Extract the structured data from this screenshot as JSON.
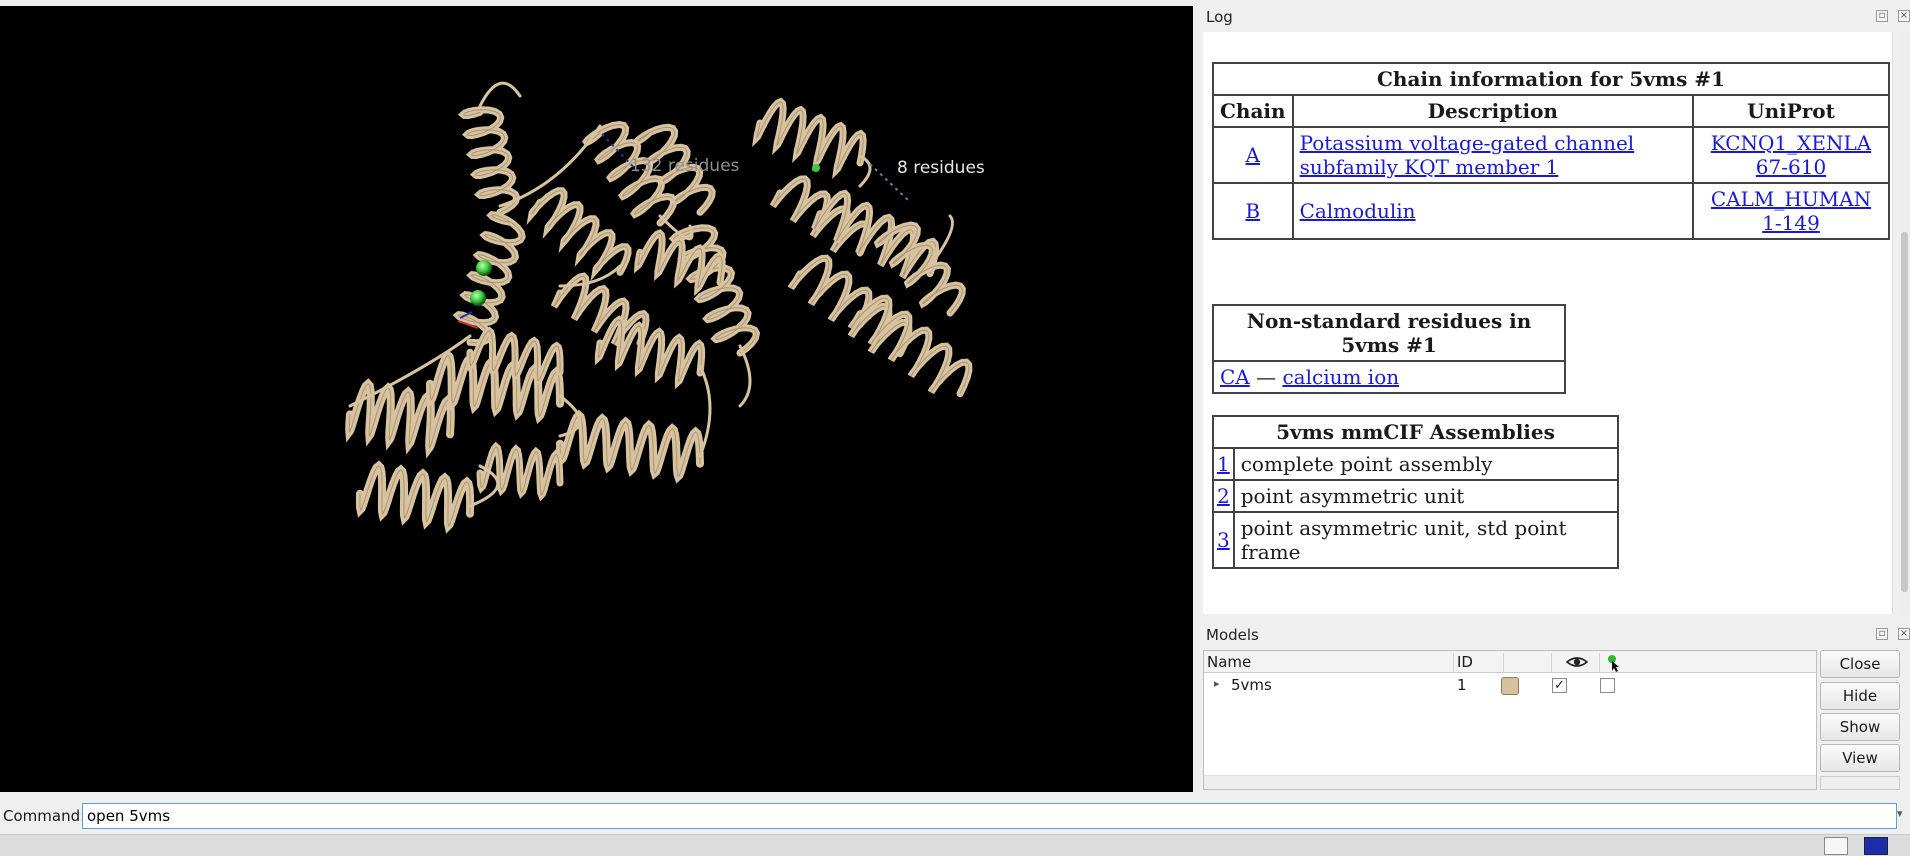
{
  "viewer": {
    "labels": {
      "residues_132": "132 residues",
      "residues_8": "8 residues"
    }
  },
  "log": {
    "title": "Log",
    "chain_table": {
      "caption": "Chain information for 5vms #1",
      "headers": [
        "Chain",
        "Description",
        "UniProt"
      ],
      "rows": [
        {
          "chain": "A",
          "description": "Potassium voltage-gated channel subfamily KQT member 1",
          "uniprot_id": "KCNQ1_XENLA",
          "uniprot_range": "67-610"
        },
        {
          "chain": "B",
          "description": "Calmodulin",
          "uniprot_id": "CALM_HUMAN",
          "uniprot_range": "1-149"
        }
      ]
    },
    "nonstd_table": {
      "caption": "Non-standard residues in 5vms #1",
      "row": {
        "code": "CA",
        "dash": "—",
        "name": "calcium ion"
      }
    },
    "assemblies_table": {
      "caption": "5vms mmCIF Assemblies",
      "rows": [
        {
          "id": "1",
          "name": "complete point assembly"
        },
        {
          "id": "2",
          "name": "point asymmetric unit"
        },
        {
          "id": "3",
          "name": "point asymmetric unit, std point frame"
        }
      ]
    }
  },
  "models": {
    "title": "Models",
    "headers": {
      "name": "Name",
      "id": "ID"
    },
    "rows": [
      {
        "name": "5vms",
        "id": "1",
        "shown": true,
        "selected": false,
        "color": "#d7c19d"
      }
    ],
    "buttons": {
      "close": "Close",
      "hide": "Hide",
      "show": "Show",
      "view": "View"
    }
  },
  "command": {
    "label": "Command:",
    "value": "open 5vms"
  },
  "colors": {
    "viewer_bg": "#000000",
    "ribbon": "#d8c3a0",
    "link": "#1a1ad6",
    "calcium": "#3cc83c"
  },
  "icons": [
    "eye-icon",
    "pointer-icon",
    "float-icon",
    "close-icon",
    "expand-arrow-icon",
    "dropdown-arrow-icon"
  ]
}
